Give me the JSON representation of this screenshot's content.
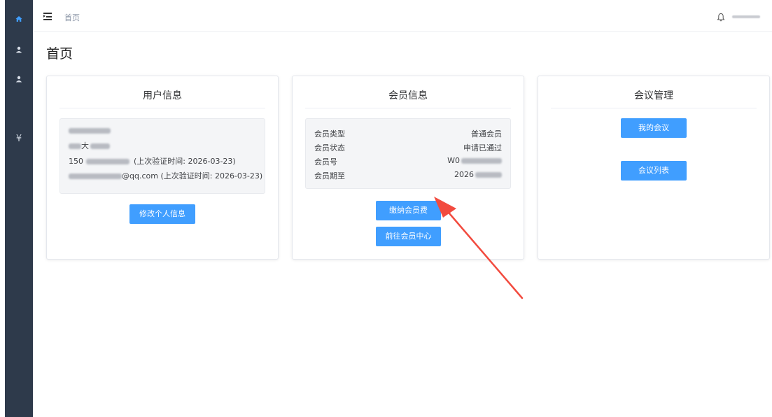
{
  "breadcrumb": {
    "home": "首页"
  },
  "page_title": "首页",
  "user_card": {
    "title": "用户信息",
    "phone_prefix": "150",
    "phone_verified": "(上次验证时间: 2026-03-23)",
    "email_suffix": "@qq.com (上次验证时间: 2026-03-23)",
    "name_suffix": "大",
    "edit_button": "修改个人信息"
  },
  "member_card": {
    "title": "会员信息",
    "rows": [
      {
        "label": "会员类型",
        "value": "普通会员"
      },
      {
        "label": "会员状态",
        "value": "申请已通过"
      },
      {
        "label": "会员号",
        "value": "W0"
      },
      {
        "label": "会员期至",
        "value": "2026"
      }
    ],
    "pay_button": "缴纳会员费",
    "center_button": "前往会员中心"
  },
  "meeting_card": {
    "title": "会议管理",
    "my_meetings_button": "我的会议",
    "meeting_list_button": "会议列表"
  },
  "sidebar": {
    "finance_glyph": "¥"
  },
  "colors": {
    "sidebar": "#2e3a4b",
    "primary": "#409eff",
    "annotation_arrow": "#f24b3f"
  },
  "icons": [
    "home-icon",
    "user-icon",
    "user-icon",
    "yen-icon",
    "menu-fold-icon",
    "bell-icon"
  ]
}
